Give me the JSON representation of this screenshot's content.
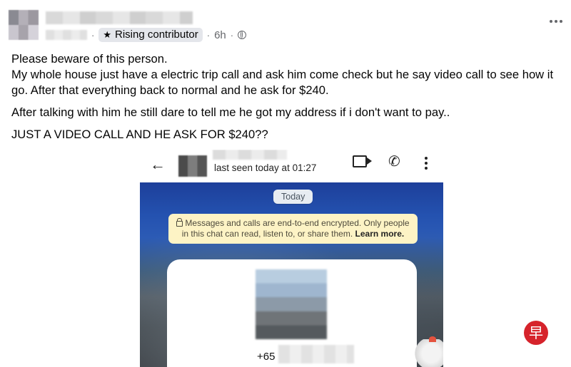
{
  "post": {
    "badge_label": "Rising contributor",
    "timestamp": "6h",
    "separator": "·",
    "text": [
      "Please beware of this person.",
      "My whole house just have a electric trip call and ask him come check but he say video call to see how it go. After that everything back to normal and he ask for $240.",
      "After talking with him he still dare to tell me he got my address if i don't want to pay..",
      "JUST A VIDEO CALL AND HE ASK FOR $240??"
    ]
  },
  "chat_screenshot": {
    "last_seen": "last seen today at 01:27",
    "date_chip": "Today",
    "encryption_note": "Messages and calls are end-to-end encrypted. Only people in this chat can read, listen to, or share them.",
    "learn_more": "Learn more.",
    "phone_prefix": "+65"
  },
  "watermark": {
    "glyph": "早"
  },
  "icons": {
    "star": "star-icon",
    "globe": "globe-icon",
    "more": "more-options-icon",
    "back": "back-arrow-icon",
    "video": "video-call-icon",
    "phone": "phone-call-icon",
    "kebab": "kebab-menu-icon",
    "lock": "lock-icon"
  },
  "colors": {
    "badge_bg": "#e4e6eb",
    "secondary_text": "#65676b",
    "encrypt_bg": "#fdf3c5",
    "watermark_red": "#d6232b"
  }
}
